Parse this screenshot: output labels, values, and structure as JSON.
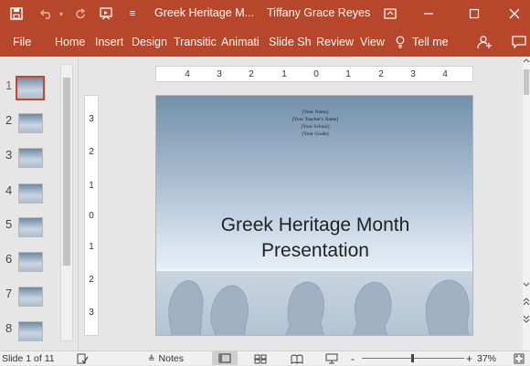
{
  "window": {
    "doc_title": "Greek Heritage M...",
    "user_name": "Tiffany Grace Reyes"
  },
  "ribbon": {
    "tabs": [
      "File",
      "Home",
      "Insert",
      "Design",
      "Transitic",
      "Animati",
      "Slide Sh",
      "Review",
      "View"
    ],
    "tell_me": "Tell me"
  },
  "rulers": {
    "horizontal": [
      "4",
      "3",
      "2",
      "1",
      "0",
      "1",
      "2",
      "3",
      "4"
    ],
    "vertical": [
      "3",
      "2",
      "1",
      "0",
      "1",
      "2",
      "3"
    ]
  },
  "thumbnails": {
    "selected_index": 0,
    "numbers": [
      "1",
      "2",
      "3",
      "4",
      "5",
      "6",
      "7",
      "8"
    ]
  },
  "slide": {
    "placeholders": [
      "[Your Name]",
      "[Your Teacher's Name]",
      "[Your School]",
      "[Your Grade]"
    ],
    "title_line1": "Greek Heritage Month",
    "title_line2": "Presentation"
  },
  "status": {
    "slide_counter": "Slide 1 of 11",
    "notes_label": "Notes",
    "zoom_minus": "-",
    "zoom_plus": "+",
    "zoom_level": "37%"
  },
  "colors": {
    "accent": "#b7472a",
    "selected_thumb_border": "#c8462a"
  }
}
